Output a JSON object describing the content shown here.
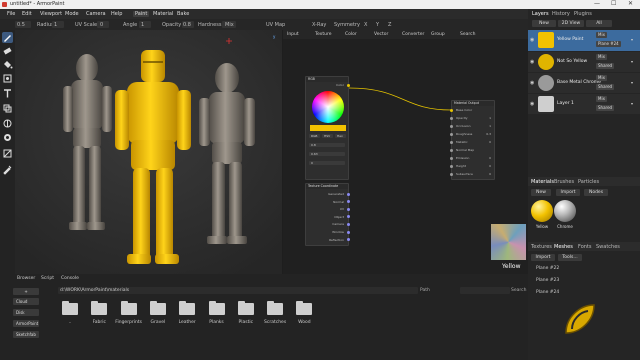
{
  "window": {
    "title": "untitled* - ArmorPaint",
    "controls": [
      "—",
      "☐",
      "✕"
    ]
  },
  "menu": {
    "items": [
      "File",
      "Edit",
      "Viewport",
      "Mode",
      "Camera",
      "Help"
    ],
    "workspace_tabs": [
      "Paint",
      "Material",
      "Bake"
    ],
    "active_workspace": "Paint"
  },
  "toolopts": {
    "size_value": "0.5",
    "radius_label": "Radius",
    "radius_value": "1",
    "uvscale_label": "UV Scale",
    "uvscale_value": "0",
    "angle_label": "Angle",
    "angle_value": "1",
    "opacity_label": "Opacity",
    "opacity_value": "0.8",
    "hardness_label": "Hardness",
    "mix_label": "Mix",
    "uvmap_label": "UV Map",
    "xray_label": "X-Ray",
    "symmetry_label": "Symmetry",
    "axis_x": "X",
    "axis_y": "Y",
    "axis_z": "Z"
  },
  "toolbar": {
    "tools": [
      "brush-icon",
      "eraser-icon",
      "fill-icon",
      "decal-icon",
      "text-icon",
      "clone-icon",
      "blur-icon",
      "particle-icon",
      "bake-icon",
      "picker-icon"
    ],
    "active_index": 0
  },
  "viewport": {
    "axis_label": "y"
  },
  "nodes": {
    "tabs": [
      "Input",
      "Texture",
      "Color",
      "Vector",
      "Converter",
      "Group",
      "Search"
    ],
    "rgb_node": {
      "title": "RGB",
      "output": "Color",
      "modes": [
        "RGB",
        "HSV",
        "Hex"
      ],
      "fields": [
        "0.8",
        "0.63",
        "0"
      ]
    },
    "texcoord_node": {
      "title": "Texture Coordinate",
      "outputs": [
        "Generated",
        "Normal",
        "UV",
        "Object",
        "Camera",
        "Window",
        "Reflection"
      ]
    },
    "output_node": {
      "title": "Material Output",
      "inputs": [
        "Base Color",
        "Opacity",
        "Occlusion",
        "Roughness",
        "Metallic",
        "Normal Map",
        "Emission",
        "Height",
        "Subsurface"
      ],
      "values": [
        "",
        "1",
        "1",
        "0.3",
        "0",
        "",
        "0",
        "0",
        "0"
      ]
    },
    "preview_label": "Yellow"
  },
  "right": {
    "tabs": [
      "Layers",
      "History",
      "Plugins"
    ],
    "new_button": "New",
    "view_2d": "2D View",
    "filter": "All",
    "layers": [
      {
        "name": "Yellow Paint",
        "blend": "Mix",
        "mask": "Plane #24",
        "active": true,
        "color": "#f2c200"
      },
      {
        "name": "Not So Yellow",
        "blend": "Mix",
        "mask": "Shared",
        "active": false,
        "color": "#e0b400"
      },
      {
        "name": "Base Metal Chrome",
        "blend": "Mix",
        "mask": "Shared",
        "active": false,
        "color": "#9a9a9a"
      },
      {
        "name": "Layer 1",
        "blend": "Mix",
        "mask": "Shared",
        "active": false,
        "color": "#cfcfcf"
      }
    ],
    "mat_tabs": [
      "Materials",
      "Brushes",
      "Particles"
    ],
    "mat_buttons": [
      "New",
      "Import",
      "Nodes"
    ],
    "materials": [
      {
        "name": "Yellow",
        "color": "#f2c200"
      },
      {
        "name": "Chrome",
        "color": "#b8b8b8"
      }
    ],
    "tex_tabs": [
      "Textures",
      "Meshes",
      "Fonts",
      "Swatches"
    ],
    "tex_buttons": [
      "Import",
      "Tools..."
    ],
    "meshes": [
      "Plane #22",
      "Plane #23",
      "Plane #24"
    ]
  },
  "browser": {
    "tabs": [
      "Browser",
      "Script",
      "Console"
    ],
    "path": "d:\\WORK\\ArmorPaint\\materials",
    "path_label": "Path",
    "search_label": "Search",
    "sidebar": [
      "+",
      "Cloud",
      "Disk",
      "ArmorPaint",
      "Sketchfab"
    ],
    "folders": [
      "..",
      "Fabric",
      "Fingerprints",
      "Gravel",
      "Leather",
      "Planks",
      "Plastic",
      "Scratches",
      "Wood"
    ]
  },
  "colors": {
    "accent": "#3c6b9e",
    "yellow": "#f2c200",
    "selected_tab": "#3e3e3e"
  }
}
